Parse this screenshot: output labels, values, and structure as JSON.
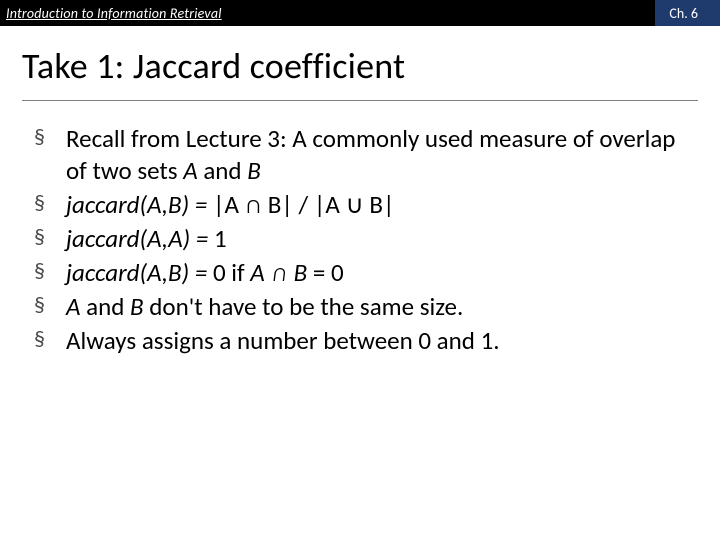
{
  "header": {
    "course": "Introduction to Information Retrieval",
    "chapter": "Ch. 6"
  },
  "title": "Take 1: Jaccard coefficient",
  "bullets": {
    "b0_pre": "Recall from Lecture 3: A commonly used measure of overlap of two sets ",
    "b0_A": "A",
    "b0_mid": " and ",
    "b0_B": "B",
    "b1_fn": "jaccard(A,B) =",
    "b1_rest": " |A ∩ B| / |A ∪ B|",
    "b2_fn": "jaccard(A,A) =",
    "b2_rest": " 1",
    "b3_fn": "jaccard(A,B) =",
    "b3_mid": " 0 if ",
    "b3_set": "A ∩ B",
    "b3_tail": " = 0",
    "b4_A": "A",
    "b4_mid": " and ",
    "b4_B": "B",
    "b4_rest": " don't have to be the same size.",
    "b5": "Always assigns a number between 0 and 1."
  }
}
